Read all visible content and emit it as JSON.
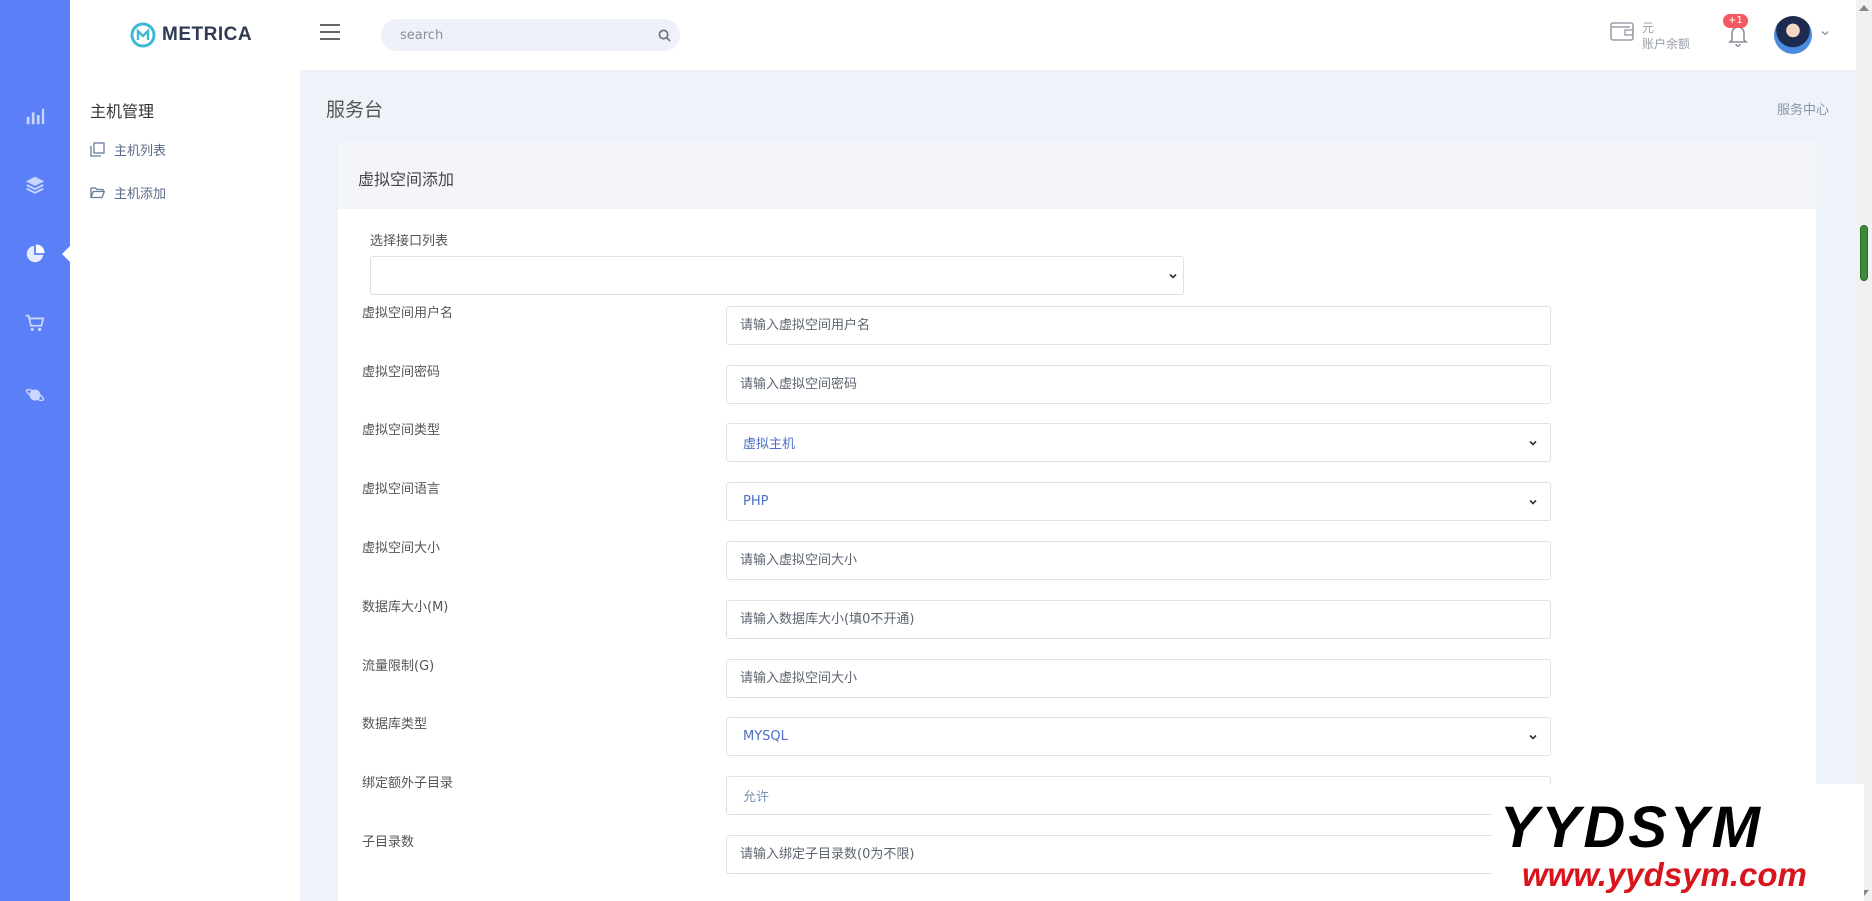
{
  "brand": {
    "name": "METRICA"
  },
  "rail": {
    "items": [
      {
        "icon": "bar-chart-icon"
      },
      {
        "icon": "layers-icon"
      },
      {
        "icon": "pie-chart-icon",
        "active": true
      },
      {
        "icon": "cart-icon"
      },
      {
        "icon": "planet-icon"
      }
    ]
  },
  "header": {
    "search_placeholder": "search",
    "wallet_unit": "元",
    "wallet_label": "账户余额",
    "notif_badge": "+1"
  },
  "subnav": {
    "title": "主机管理",
    "items": [
      {
        "label": "主机列表",
        "icon": "copy-icon"
      },
      {
        "label": "主机添加",
        "icon": "folder-open-icon"
      }
    ]
  },
  "page": {
    "title": "服务台",
    "breadcrumb": "服务中心"
  },
  "card": {
    "title": "虚拟空间添加"
  },
  "form": {
    "interface_label": "选择接口列表",
    "interface_value": "",
    "username": {
      "label": "虚拟空间用户名",
      "placeholder": "请输入虚拟空间用户名"
    },
    "password": {
      "label": "虚拟空间密码",
      "placeholder": "请输入虚拟空间密码"
    },
    "type": {
      "label": "虚拟空间类型",
      "value": "虚拟主机"
    },
    "language": {
      "label": "虚拟空间语言",
      "value": "PHP"
    },
    "size": {
      "label": "虚拟空间大小",
      "placeholder": "请输入虚拟空间大小"
    },
    "db_size": {
      "label": "数据库大小(M)",
      "placeholder": "请输入数据库大小(填0不开通)"
    },
    "traffic": {
      "label": "流量限制(G)",
      "placeholder": "请输入虚拟空间大小"
    },
    "db_type": {
      "label": "数据库类型",
      "value": "MYSQL"
    },
    "bind_subdir": {
      "label": "绑定额外子目录",
      "value": "允许"
    },
    "subdir_count": {
      "label": "子目录数",
      "placeholder": "请输入绑定子目录数(0为不限)"
    }
  },
  "watermark": {
    "title": "YYDSYM",
    "url": "www.yydsym.com"
  },
  "colors": {
    "rail": "#5b7ff6",
    "accent_text": "#4d6fc5",
    "badge": "#f25961",
    "watermark_url": "#d8141d"
  }
}
